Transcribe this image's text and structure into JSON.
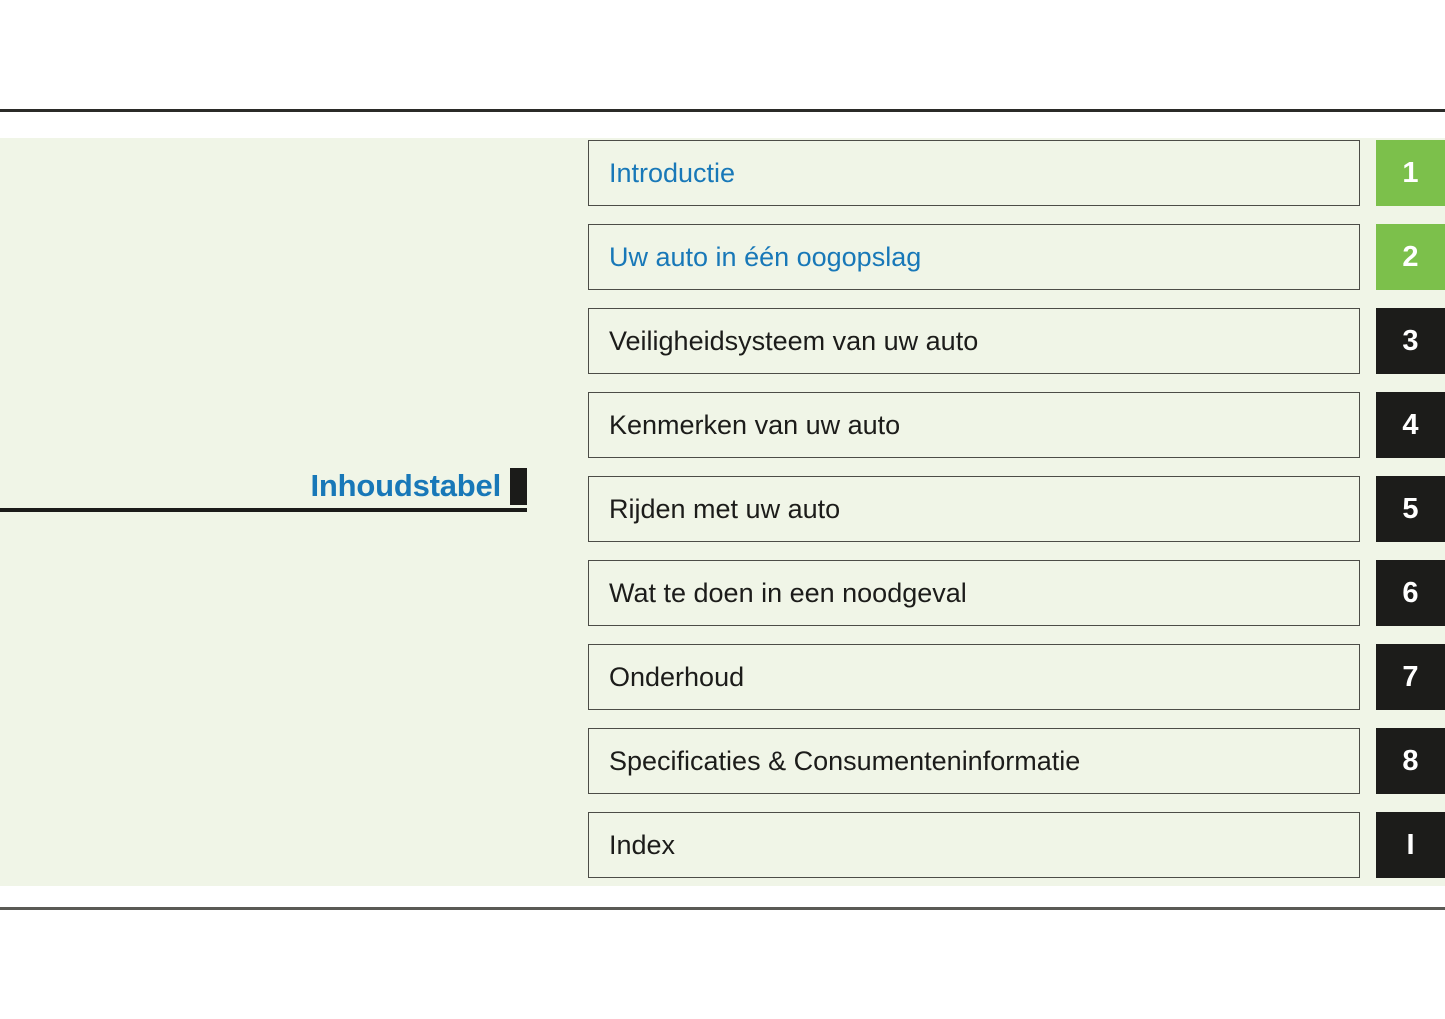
{
  "document": {
    "title": "Inhoudstabel",
    "title_marker": "black-square-marker"
  },
  "colors": {
    "panel_background": "#f0f5e7",
    "link_blue": "#1878b8",
    "tab_green": "#7cc04b",
    "tab_dark": "#1c1c1a",
    "rule_dark": "#2b2b28",
    "text_dark": "#1c1c1a"
  },
  "toc": {
    "rows": [
      {
        "label": "Introductie",
        "tab": "1",
        "tab_style": "green",
        "is_link": true
      },
      {
        "label": "Uw auto in één oogopslag",
        "tab": "2",
        "tab_style": "green",
        "is_link": true
      },
      {
        "label": "Veiligheidsysteem van uw auto",
        "tab": "3",
        "tab_style": "dark",
        "is_link": false
      },
      {
        "label": "Kenmerken van uw auto",
        "tab": "4",
        "tab_style": "dark",
        "is_link": false
      },
      {
        "label": "Rijden met uw auto",
        "tab": "5",
        "tab_style": "dark",
        "is_link": false
      },
      {
        "label": "Wat te doen in een noodgeval",
        "tab": "6",
        "tab_style": "dark",
        "is_link": false
      },
      {
        "label": "Onderhoud",
        "tab": "7",
        "tab_style": "dark",
        "is_link": false
      },
      {
        "label": "Specificaties & Consumenteninformatie",
        "tab": "8",
        "tab_style": "dark",
        "is_link": false
      },
      {
        "label": "Index",
        "tab": "I",
        "tab_style": "dark",
        "is_link": false
      }
    ]
  }
}
